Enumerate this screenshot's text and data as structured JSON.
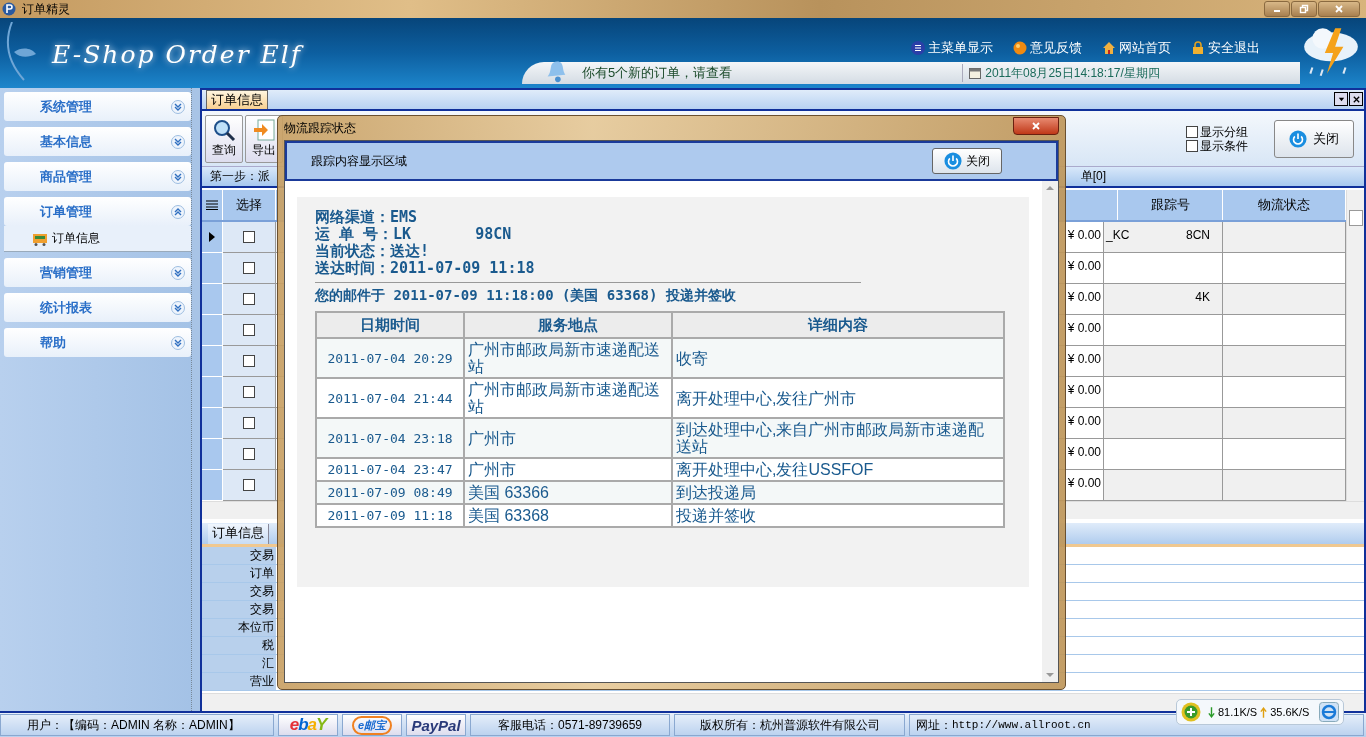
{
  "window": {
    "title": "订单精灵"
  },
  "header": {
    "logo": "E-Shop Order Elf",
    "nav": [
      {
        "label": "主菜单显示"
      },
      {
        "label": "意见反馈"
      },
      {
        "label": "网站首页"
      },
      {
        "label": "安全退出"
      }
    ],
    "notice": "你有5个新的订单，请查看",
    "datetime": "2011年08月25日14:18:17/星期四"
  },
  "sidebar": {
    "items": [
      {
        "label": "系统管理",
        "expanded": false
      },
      {
        "label": "基本信息",
        "expanded": false
      },
      {
        "label": "商品管理",
        "expanded": false
      },
      {
        "label": "订单管理",
        "expanded": true,
        "children": [
          {
            "label": "订单信息"
          }
        ]
      },
      {
        "label": "营销管理",
        "expanded": false
      },
      {
        "label": "统计报表",
        "expanded": false
      },
      {
        "label": "帮助",
        "expanded": false
      }
    ]
  },
  "main": {
    "tabs": [
      {
        "label": "订单信息",
        "selected": true
      }
    ],
    "toolbar": [
      {
        "label": "查询"
      },
      {
        "label": "导出"
      }
    ],
    "options": [
      {
        "label": "显示分组",
        "checked": false
      },
      {
        "label": "显示条件",
        "checked": false
      }
    ],
    "close_button": "关闭",
    "step_left": "第一步：派",
    "step_right": "单[0]",
    "grid": {
      "columns": [
        "选择",
        "跟踪号",
        "物流状态"
      ],
      "rows": [
        {
          "current": true,
          "checked": false,
          "amount": "¥ 0.00",
          "tracking": [
            "_KC",
            "8CN"
          ]
        },
        {
          "current": false,
          "checked": false,
          "amount": "¥ 0.00"
        },
        {
          "current": false,
          "checked": false,
          "amount": "¥ 0.00",
          "tracking": [
            "4K"
          ]
        },
        {
          "current": false,
          "checked": false,
          "amount": "¥ 0.00"
        },
        {
          "current": false,
          "checked": false,
          "amount": "¥ 0.00"
        },
        {
          "current": false,
          "checked": false,
          "amount": "¥ 0.00"
        },
        {
          "current": false,
          "checked": false,
          "amount": "¥ 0.00"
        },
        {
          "current": false,
          "checked": false,
          "amount": "¥ 0.00"
        },
        {
          "current": false,
          "checked": false,
          "amount": "¥ 0.00"
        }
      ]
    },
    "detail": {
      "tabs": [
        {
          "label": "订单信息",
          "selected": true
        }
      ],
      "fields": [
        "交易",
        "订单",
        "交易",
        "交易",
        "本位币",
        "税",
        "汇",
        "营业"
      ]
    }
  },
  "dialog": {
    "title": "物流跟踪状态",
    "header": "跟踪内容显示区域",
    "close_button": "关闭",
    "info": [
      {
        "label": "网络渠道：",
        "values": [
          "EMS"
        ]
      },
      {
        "label": "运 单 号：",
        "values": [
          "LK",
          "98CN"
        ]
      },
      {
        "label": "当前状态：",
        "values": [
          "送达!"
        ]
      },
      {
        "label": "送达时间：",
        "values": [
          "2011-07-09 11:18"
        ]
      }
    ],
    "summary": "您的邮件于 2011-07-09 11:18:00 (美国 63368) 投递并签收",
    "table": {
      "columns": [
        "日期时间",
        "服务地点",
        "详细内容"
      ],
      "rows": [
        [
          "2011-07-04 20:29",
          "广州市邮政局新市速递配送站",
          "收寄"
        ],
        [
          "2011-07-04 21:44",
          "广州市邮政局新市速递配送站",
          "离开处理中心,发往广州市"
        ],
        [
          "2011-07-04 23:18",
          "广州市",
          "到达处理中心,来自广州市邮政局新市速递配送站"
        ],
        [
          "2011-07-04 23:47",
          "广州市",
          "离开处理中心,发往USSFOF"
        ],
        [
          "2011-07-09 08:49",
          "美国 63366",
          "到达投递局"
        ],
        [
          "2011-07-09 11:18",
          "美国 63368",
          "投递并签收"
        ]
      ]
    }
  },
  "status_bar": {
    "user": "用户：【编码：ADMIN  名称：ADMIN】",
    "logos": [
      {
        "kind": "ebay",
        "text": "ebaY"
      },
      {
        "kind": "youbao",
        "text": "e邮宝"
      },
      {
        "kind": "paypal",
        "text": "PayPal"
      }
    ],
    "phone": "客服电话：0571-89739659",
    "copyright": "版权所有：杭州普源软件有限公司",
    "website_label": "网址：",
    "website": "http://www.allroot.cn"
  },
  "net_monitor": {
    "down": "81.1K/S",
    "up": "35.6K/S"
  }
}
